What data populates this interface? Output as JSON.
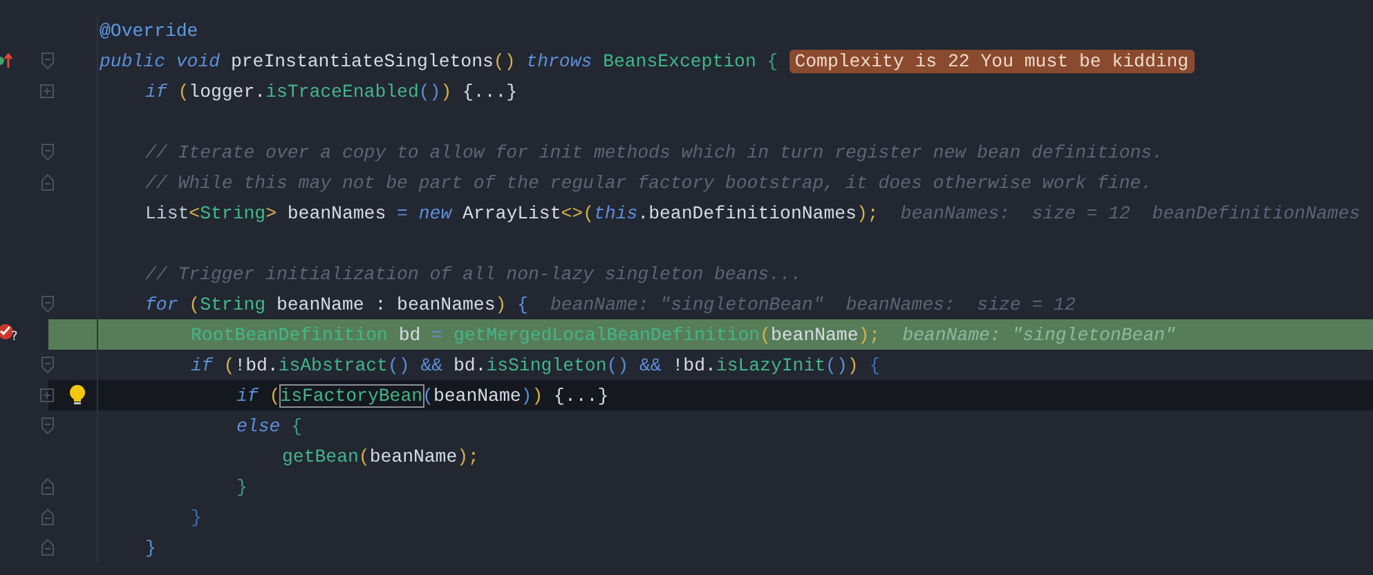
{
  "editor": {
    "lines": [
      {
        "kind": "code",
        "tokens": [
          {
            "text": "@Override",
            "kind": "annotation"
          }
        ]
      },
      {
        "kind": "code",
        "gutter": {
          "kind": "override"
        },
        "fold": {
          "kind": "start"
        },
        "tokens": [
          {
            "text": "public",
            "kind": "keyword"
          },
          {
            "text": " void",
            "kind": "keyword"
          },
          {
            "text": " preInstantiateSingletons",
            "kind": "plain"
          },
          {
            "text": "()",
            "kind": "paren1"
          },
          {
            "text": " throws",
            "kind": "keyword"
          },
          {
            "text": " BeansException",
            "kind": "type"
          },
          {
            "text": " {",
            "kind": "brace"
          }
        ],
        "badge": "Complexity is 22 You must be kidding",
        "children": [
          {
            "kind": "code",
            "fold": {
              "kind": "collapsed"
            },
            "tokens": [
              {
                "text": "if",
                "kind": "keyword"
              },
              {
                "text": " (",
                "kind": "paren1"
              },
              {
                "text": "logger.",
                "kind": "plain"
              },
              {
                "text": "isTraceEnabled",
                "kind": "method"
              },
              {
                "text": "()",
                "kind": "paren2"
              },
              {
                "text": ")",
                "kind": "paren1"
              },
              {
                "text": " {...}",
                "kind": "plain"
              }
            ]
          },
          {
            "kind": "blank"
          },
          {
            "kind": "code",
            "fold": {
              "kind": "start"
            },
            "tokens": [
              {
                "text": "// Iterate over a copy to allow for init methods which in turn register new bean definitions.",
                "kind": "comment"
              }
            ]
          },
          {
            "kind": "code",
            "fold": {
              "kind": "end"
            },
            "tokens": [
              {
                "text": "// While this may not be part of the regular factory bootstrap, it does otherwise work fine.",
                "kind": "comment"
              }
            ]
          },
          {
            "kind": "code",
            "tokens": [
              {
                "text": "List",
                "kind": "plain2"
              },
              {
                "text": "<",
                "kind": "punct"
              },
              {
                "text": "String",
                "kind": "type"
              },
              {
                "text": ">",
                "kind": "punct"
              },
              {
                "text": " beanNames ",
                "kind": "plain"
              },
              {
                "text": "=",
                "kind": "operator"
              },
              {
                "text": " new",
                "kind": "keyword"
              },
              {
                "text": " ArrayList",
                "kind": "plain"
              },
              {
                "text": "<>(",
                "kind": "paren1"
              },
              {
                "text": "this",
                "kind": "keyword"
              },
              {
                "text": ".beanDefinitionNames",
                "kind": "plain"
              },
              {
                "text": ");",
                "kind": "paren1"
              }
            ],
            "hint": "beanNames:  size = 12  beanDefinitionNames"
          },
          {
            "kind": "blank"
          },
          {
            "kind": "code",
            "tokens": [
              {
                "text": "// Trigger initialization of all non-lazy singleton beans...",
                "kind": "comment"
              }
            ]
          },
          {
            "kind": "code",
            "fold": {
              "kind": "start"
            },
            "tokens": [
              {
                "text": "for",
                "kind": "keyword"
              },
              {
                "text": " (",
                "kind": "paren1"
              },
              {
                "text": "String",
                "kind": "type"
              },
              {
                "text": " beanName : beanNames",
                "kind": "plain"
              },
              {
                "text": ")",
                "kind": "paren1"
              },
              {
                "text": " {",
                "kind": "brace2"
              }
            ],
            "hint": "beanName: \"singletonBean\"  beanNames:  size = 12",
            "children": [
              {
                "kind": "code",
                "highlighted": true,
                "gutter": {
                  "kind": "breakpoint",
                  "mark": "?"
                },
                "tokens": [
                  {
                    "text": "RootBeanDefinition",
                    "kind": "type"
                  },
                  {
                    "text": " bd ",
                    "kind": "plain"
                  },
                  {
                    "text": "=",
                    "kind": "operator"
                  },
                  {
                    "text": " getMergedLocalBeanDefinition",
                    "kind": "method"
                  },
                  {
                    "text": "(",
                    "kind": "paren1"
                  },
                  {
                    "text": "beanName",
                    "kind": "plain"
                  },
                  {
                    "text": ");",
                    "kind": "paren1"
                  }
                ],
                "hint": "beanName: \"singletonBean\""
              },
              {
                "kind": "code",
                "fold": {
                  "kind": "start"
                },
                "tokens": [
                  {
                    "text": "if",
                    "kind": "keyword"
                  },
                  {
                    "text": " (",
                    "kind": "paren1"
                  },
                  {
                    "text": "!bd.",
                    "kind": "plain"
                  },
                  {
                    "text": "isAbstract",
                    "kind": "method"
                  },
                  {
                    "text": "()",
                    "kind": "paren2"
                  },
                  {
                    "text": " &&",
                    "kind": "operator"
                  },
                  {
                    "text": " bd.",
                    "kind": "plain"
                  },
                  {
                    "text": "isSingleton",
                    "kind": "method"
                  },
                  {
                    "text": "()",
                    "kind": "paren2"
                  },
                  {
                    "text": " &&",
                    "kind": "operator"
                  },
                  {
                    "text": " !bd.",
                    "kind": "plain"
                  },
                  {
                    "text": "isLazyInit",
                    "kind": "method"
                  },
                  {
                    "text": "()",
                    "kind": "paren2"
                  },
                  {
                    "text": ")",
                    "kind": "paren1"
                  },
                  {
                    "text": " {",
                    "kind": "brace3"
                  }
                ],
                "children": [
                  {
                    "kind": "code",
                    "current": true,
                    "intention": true,
                    "fold": {
                      "kind": "collapsed"
                    },
                    "tokens": [
                      {
                        "text": "if",
                        "kind": "keyword"
                      },
                      {
                        "text": " (",
                        "kind": "paren1"
                      },
                      {
                        "text": "isFactoryBean",
                        "kind": "method",
                        "boxed": true
                      },
                      {
                        "text": "(",
                        "kind": "paren2"
                      },
                      {
                        "text": "beanName",
                        "kind": "plain"
                      },
                      {
                        "text": ")",
                        "kind": "paren2"
                      },
                      {
                        "text": ")",
                        "kind": "paren1"
                      },
                      {
                        "text": " {...}",
                        "kind": "plain"
                      }
                    ]
                  },
                  {
                    "kind": "code",
                    "fold": {
                      "kind": "start"
                    },
                    "tokens": [
                      {
                        "text": "else",
                        "kind": "keyword"
                      },
                      {
                        "text": " {",
                        "kind": "brace"
                      }
                    ],
                    "children": [
                      {
                        "kind": "code",
                        "tokens": [
                          {
                            "text": "getBean",
                            "kind": "method"
                          },
                          {
                            "text": "(",
                            "kind": "paren1"
                          },
                          {
                            "text": "beanName",
                            "kind": "plain"
                          },
                          {
                            "text": ");",
                            "kind": "paren1"
                          }
                        ]
                      }
                    ]
                  },
                  {
                    "kind": "code",
                    "fold": {
                      "kind": "end"
                    },
                    "tokens": [
                      {
                        "text": "}",
                        "kind": "brace"
                      }
                    ]
                  }
                ]
              },
              {
                "kind": "code",
                "fold": {
                  "kind": "end"
                },
                "tokens": [
                  {
                    "text": "}",
                    "kind": "brace3"
                  }
                ]
              }
            ]
          },
          {
            "kind": "code",
            "fold": {
              "kind": "end"
            },
            "tokens": [
              {
                "text": "}",
                "kind": "brace2"
              }
            ]
          }
        ]
      }
    ]
  }
}
